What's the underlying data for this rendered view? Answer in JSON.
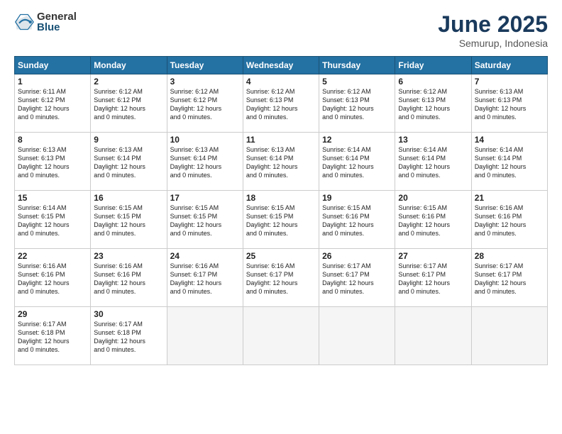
{
  "logo": {
    "general": "General",
    "blue": "Blue"
  },
  "title": "June 2025",
  "subtitle": "Semurup, Indonesia",
  "headers": [
    "Sunday",
    "Monday",
    "Tuesday",
    "Wednesday",
    "Thursday",
    "Friday",
    "Saturday"
  ],
  "weeks": [
    [
      {
        "day": "1",
        "sunrise": "6:11 AM",
        "sunset": "6:12 PM",
        "daylight": "12 hours and 0 minutes."
      },
      {
        "day": "2",
        "sunrise": "6:12 AM",
        "sunset": "6:12 PM",
        "daylight": "12 hours and 0 minutes."
      },
      {
        "day": "3",
        "sunrise": "6:12 AM",
        "sunset": "6:12 PM",
        "daylight": "12 hours and 0 minutes."
      },
      {
        "day": "4",
        "sunrise": "6:12 AM",
        "sunset": "6:13 PM",
        "daylight": "12 hours and 0 minutes."
      },
      {
        "day": "5",
        "sunrise": "6:12 AM",
        "sunset": "6:13 PM",
        "daylight": "12 hours and 0 minutes."
      },
      {
        "day": "6",
        "sunrise": "6:12 AM",
        "sunset": "6:13 PM",
        "daylight": "12 hours and 0 minutes."
      },
      {
        "day": "7",
        "sunrise": "6:13 AM",
        "sunset": "6:13 PM",
        "daylight": "12 hours and 0 minutes."
      }
    ],
    [
      {
        "day": "8",
        "sunrise": "6:13 AM",
        "sunset": "6:13 PM",
        "daylight": "12 hours and 0 minutes."
      },
      {
        "day": "9",
        "sunrise": "6:13 AM",
        "sunset": "6:14 PM",
        "daylight": "12 hours and 0 minutes."
      },
      {
        "day": "10",
        "sunrise": "6:13 AM",
        "sunset": "6:14 PM",
        "daylight": "12 hours and 0 minutes."
      },
      {
        "day": "11",
        "sunrise": "6:13 AM",
        "sunset": "6:14 PM",
        "daylight": "12 hours and 0 minutes."
      },
      {
        "day": "12",
        "sunrise": "6:14 AM",
        "sunset": "6:14 PM",
        "daylight": "12 hours and 0 minutes."
      },
      {
        "day": "13",
        "sunrise": "6:14 AM",
        "sunset": "6:14 PM",
        "daylight": "12 hours and 0 minutes."
      },
      {
        "day": "14",
        "sunrise": "6:14 AM",
        "sunset": "6:14 PM",
        "daylight": "12 hours and 0 minutes."
      }
    ],
    [
      {
        "day": "15",
        "sunrise": "6:14 AM",
        "sunset": "6:15 PM",
        "daylight": "12 hours and 0 minutes."
      },
      {
        "day": "16",
        "sunrise": "6:15 AM",
        "sunset": "6:15 PM",
        "daylight": "12 hours and 0 minutes."
      },
      {
        "day": "17",
        "sunrise": "6:15 AM",
        "sunset": "6:15 PM",
        "daylight": "12 hours and 0 minutes."
      },
      {
        "day": "18",
        "sunrise": "6:15 AM",
        "sunset": "6:15 PM",
        "daylight": "12 hours and 0 minutes."
      },
      {
        "day": "19",
        "sunrise": "6:15 AM",
        "sunset": "6:16 PM",
        "daylight": "12 hours and 0 minutes."
      },
      {
        "day": "20",
        "sunrise": "6:15 AM",
        "sunset": "6:16 PM",
        "daylight": "12 hours and 0 minutes."
      },
      {
        "day": "21",
        "sunrise": "6:16 AM",
        "sunset": "6:16 PM",
        "daylight": "12 hours and 0 minutes."
      }
    ],
    [
      {
        "day": "22",
        "sunrise": "6:16 AM",
        "sunset": "6:16 PM",
        "daylight": "12 hours and 0 minutes."
      },
      {
        "day": "23",
        "sunrise": "6:16 AM",
        "sunset": "6:16 PM",
        "daylight": "12 hours and 0 minutes."
      },
      {
        "day": "24",
        "sunrise": "6:16 AM",
        "sunset": "6:17 PM",
        "daylight": "12 hours and 0 minutes."
      },
      {
        "day": "25",
        "sunrise": "6:16 AM",
        "sunset": "6:17 PM",
        "daylight": "12 hours and 0 minutes."
      },
      {
        "day": "26",
        "sunrise": "6:17 AM",
        "sunset": "6:17 PM",
        "daylight": "12 hours and 0 minutes."
      },
      {
        "day": "27",
        "sunrise": "6:17 AM",
        "sunset": "6:17 PM",
        "daylight": "12 hours and 0 minutes."
      },
      {
        "day": "28",
        "sunrise": "6:17 AM",
        "sunset": "6:17 PM",
        "daylight": "12 hours and 0 minutes."
      }
    ],
    [
      {
        "day": "29",
        "sunrise": "6:17 AM",
        "sunset": "6:18 PM",
        "daylight": "12 hours and 0 minutes."
      },
      {
        "day": "30",
        "sunrise": "6:17 AM",
        "sunset": "6:18 PM",
        "daylight": "12 hours and 0 minutes."
      },
      null,
      null,
      null,
      null,
      null
    ]
  ]
}
